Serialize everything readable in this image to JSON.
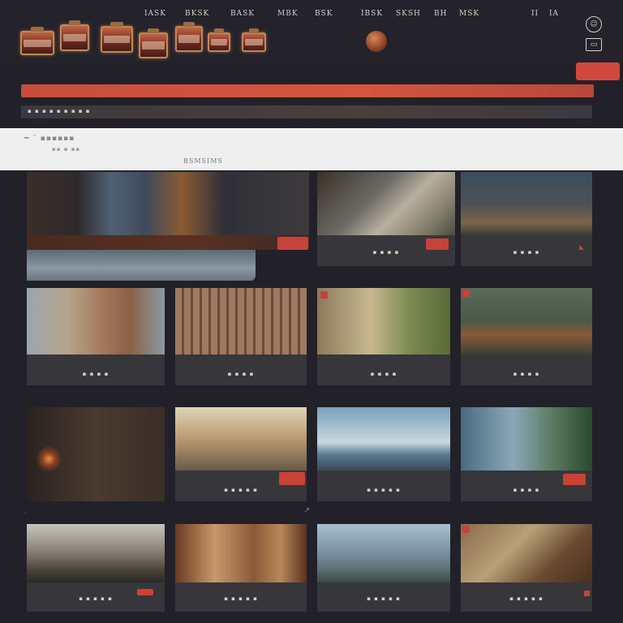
{
  "nav": {
    "items": [
      "IASK",
      "BKSK",
      "BASK",
      "MBK",
      "BSK",
      "IBSK",
      "SKSH",
      "BH",
      "MSK",
      "II",
      "IA"
    ],
    "profile_icon": "profile-icon",
    "bag_icon": "bag-icon"
  },
  "cta": {
    "label": ""
  },
  "promo_bar": {
    "text": ""
  },
  "sub_bar": {
    "text": "▪ ▪ ▪ ▪ ▪ ▪ ▪ ▪ ▪"
  },
  "band": {
    "title": "━ ¨ ▪▪▪▪▪▪",
    "subtitle": "▪▪ ▪ ▪▪",
    "caption": "BSMSIMS"
  },
  "cards": [
    {
      "caption": ""
    },
    {
      "caption": "▪ ▪ ▪ ▪"
    },
    {
      "caption": "▪ ▪ ▪ ▪"
    },
    {
      "caption": "▪ ▪ ▪ ▪"
    },
    {
      "caption": "▪ ▪ ▪ ▪"
    },
    {
      "caption": "▪ ▪ ▪ ▪"
    },
    {
      "caption": "▪ ▪ ▪ ▪"
    },
    {
      "caption": ""
    },
    {
      "caption": "▪ ▪ ▪ ▪ ▪"
    },
    {
      "caption": "▪ ▪ ▪ ▪ ▪"
    },
    {
      "caption": "▪ ▪ ▪ ▪"
    },
    {
      "caption": "▪ ▪ ▪ ▪ ▪"
    },
    {
      "caption": "▪ ▪ ▪ ▪ ▪"
    },
    {
      "caption": "▪ ▪ ▪ ▪ ▪"
    },
    {
      "caption": "▪ ▪ ▪ ▪ ▪"
    }
  ],
  "colors": {
    "accent": "#c9423a",
    "background": "#22212a",
    "card": "#37373b"
  }
}
